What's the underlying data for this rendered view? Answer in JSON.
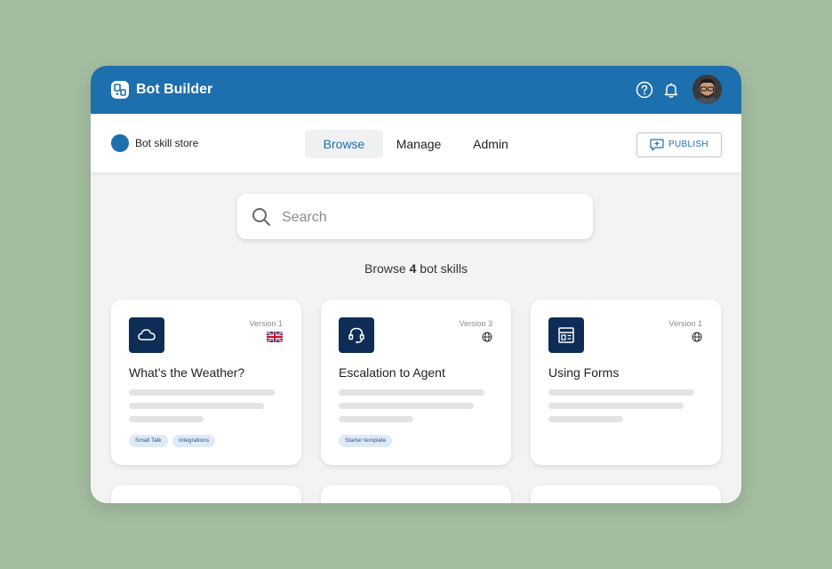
{
  "app": {
    "title": "Bot Builder"
  },
  "subnav": {
    "store_label": "Bot skill store",
    "tabs": [
      {
        "label": "Browse",
        "active": true
      },
      {
        "label": "Manage",
        "active": false
      },
      {
        "label": "Admin",
        "active": false
      }
    ],
    "publish_label": "PUBLISH"
  },
  "search": {
    "placeholder": "Search",
    "value": ""
  },
  "browse": {
    "prefix": "Browse",
    "count": "4",
    "suffix": "bot skills"
  },
  "cards": [
    {
      "title": "What’s the Weather?",
      "version": "Version 1",
      "icon": "cloud-icon",
      "locale": "uk-flag-icon",
      "tags": [
        "Small Talk",
        "Integrations"
      ]
    },
    {
      "title": "Escalation to Agent",
      "version": "Version 3",
      "icon": "headset-icon",
      "locale": "globe-icon",
      "tags": [
        "Starter template"
      ]
    },
    {
      "title": "Using Forms",
      "version": "Version 1",
      "icon": "form-layout-icon",
      "locale": "globe-icon",
      "tags": []
    }
  ],
  "colors": {
    "brand": "#1d6fad",
    "card_icon_bg": "#0d2d57",
    "background": "#a3bc9f",
    "tag_bg": "#dfeaf6"
  }
}
